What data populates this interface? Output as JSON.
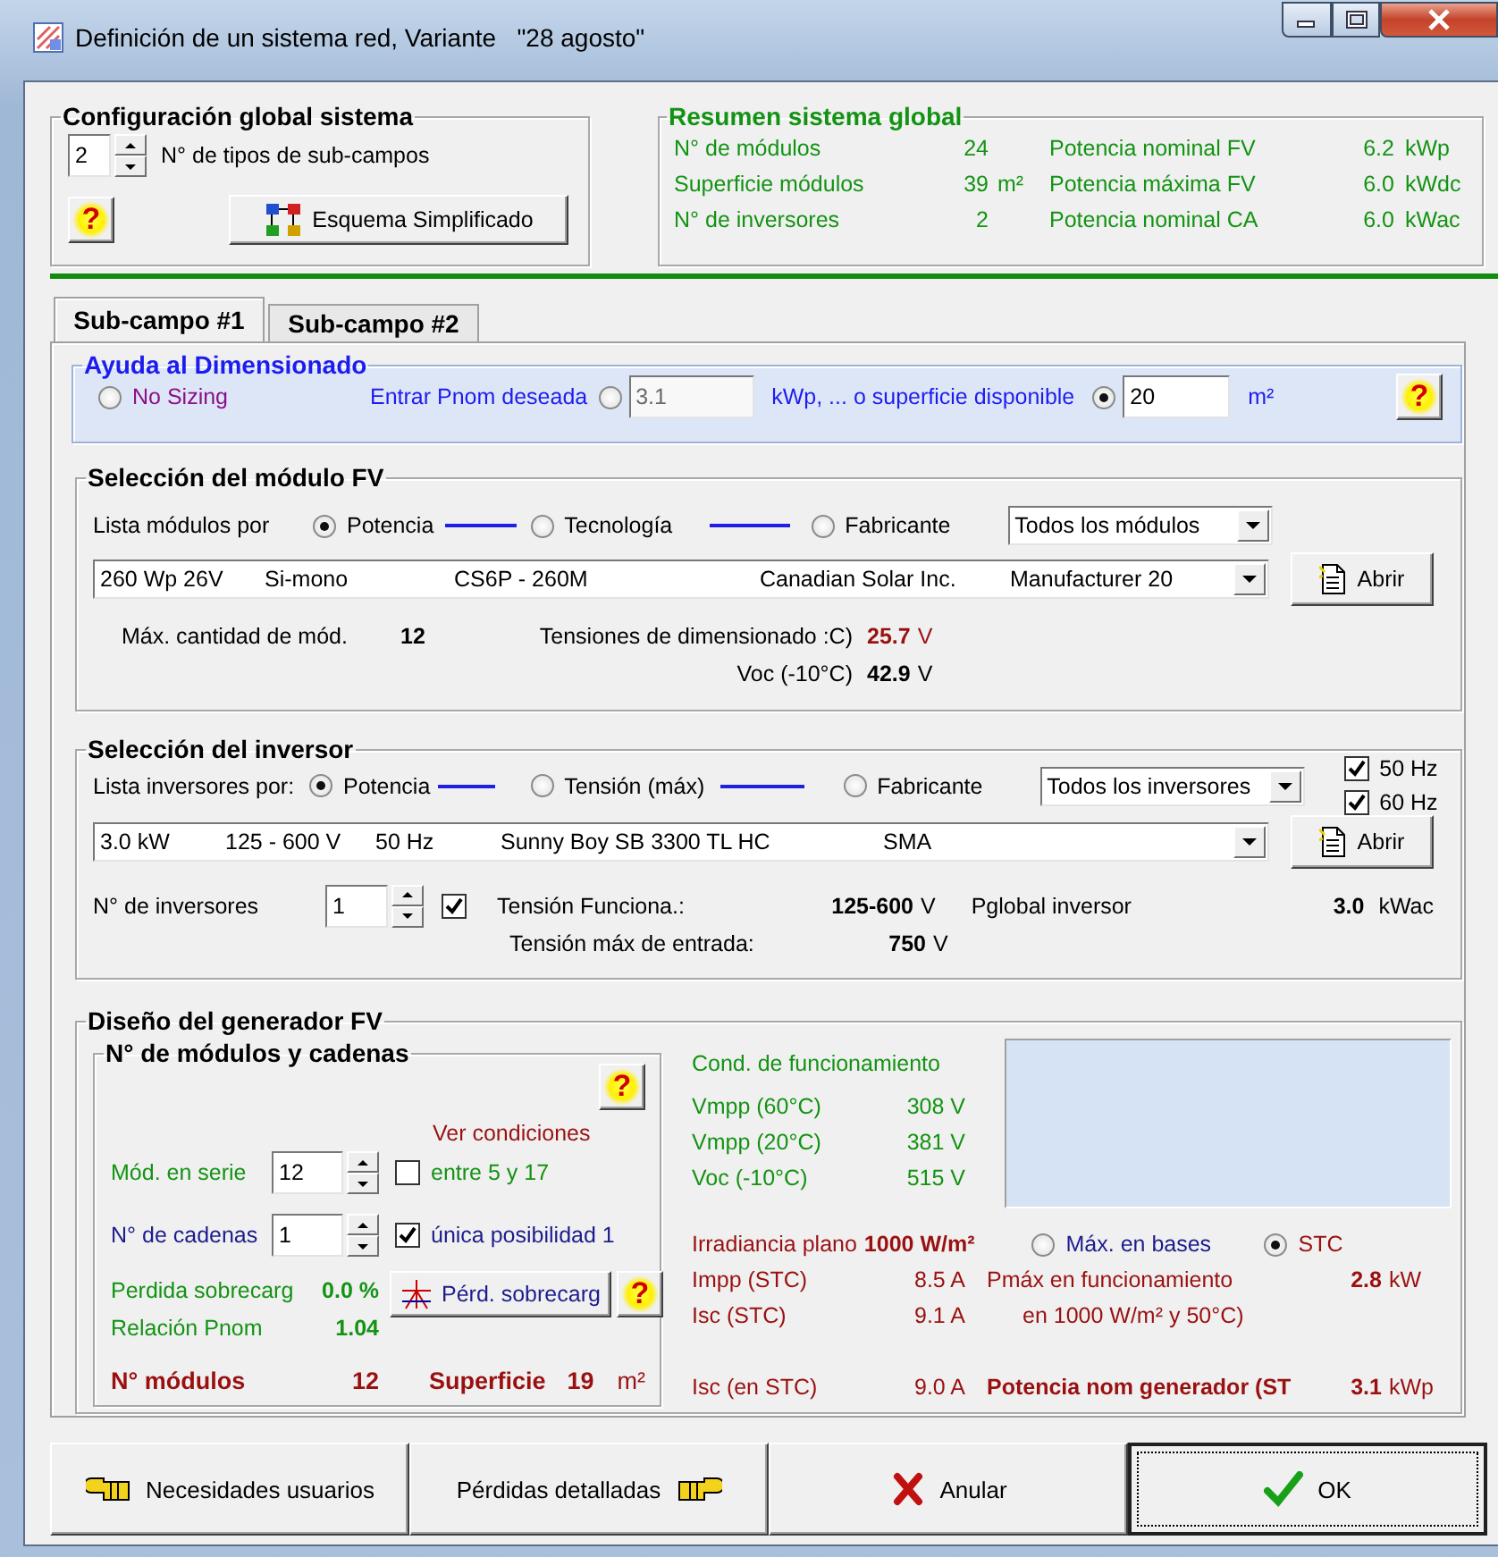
{
  "window": {
    "title": "Definición de un sistema red, Variante   \"28 agosto\""
  },
  "global_config": {
    "title": "Configuración global sistema",
    "subfield_types": "2",
    "subfield_types_label": "N° de tipos de sub-campos",
    "help": "?",
    "schema_button": "Esquema Simplificado"
  },
  "summary": {
    "title": "Resumen sistema global",
    "rows": [
      {
        "label": "N° de módulos",
        "value": "24",
        "label_2": "Potencia nominal FV",
        "value_2": "6.2",
        "unit_2": "kWp"
      },
      {
        "label": "Superficie módulos",
        "value": "39",
        "unit": "m²",
        "label_2": "Potencia máxima FV",
        "value_2": "6.0",
        "unit_2": "kWdc"
      },
      {
        "label": "N° de inversores",
        "value": "2",
        "label_2": "Potencia nominal CA",
        "value_2": "6.0",
        "unit_2": "kWac"
      }
    ]
  },
  "tabs": [
    {
      "label": "Sub-campo #1",
      "selected": true
    },
    {
      "label": "Sub-campo #2",
      "selected": false
    }
  ],
  "sizing": {
    "title": "Ayuda al Dimensionado",
    "no_sizing": {
      "label": "No Sizing",
      "selected": false
    },
    "power": {
      "label": "Entrar Pnom deseada",
      "selected": false,
      "value": "3.1",
      "unit": "kWp, ... o superficie disponible"
    },
    "area": {
      "selected": true,
      "value": "20",
      "unit": "m²"
    },
    "help": "?"
  },
  "module": {
    "title": "Selección del módulo FV",
    "sort_label": "Lista módulos por",
    "sort_by": [
      {
        "label": "Potencia",
        "selected": true
      },
      {
        "label": "Tecnología",
        "selected": false
      },
      {
        "label": "Fabricante",
        "selected": false
      }
    ],
    "filter": "Todos los módulos",
    "selection": [
      "260 Wp 26V",
      "Si-mono",
      "CS6P - 260M",
      "Canadian Solar Inc.",
      "Manufacturer 20"
    ],
    "open_button": "Abrir",
    "max_label": "Máx. cantidad de mód.",
    "max_value": "12",
    "voltages": [
      {
        "label": "Tensiones de dimensionado :C)",
        "value": "25.7",
        "unit": "V",
        "warning": true
      },
      {
        "label": "Voc (-10°C)",
        "value": "42.9",
        "unit": "V",
        "warning": false
      }
    ]
  },
  "inverter": {
    "title": "Selección del inversor",
    "sort_label": "Lista inversores por:",
    "sort_by": [
      {
        "label": "Potencia",
        "selected": true
      },
      {
        "label": "Tensión (máx)",
        "selected": false
      },
      {
        "label": "Fabricante",
        "selected": false
      }
    ],
    "filter": "Todos los inversores",
    "frequencies": [
      {
        "label": "50 Hz",
        "checked": true
      },
      {
        "label": "60 Hz",
        "checked": true
      }
    ],
    "selection": [
      "3.0 kW",
      "125 - 600 V",
      "50 Hz",
      "Sunny Boy SB 3300 TL HC",
      "SMA"
    ],
    "open_button": "Abrir",
    "count_label": "N° de inversores",
    "count": "1",
    "count_checked": true,
    "voltages": [
      {
        "label": "Tensión Funciona.:",
        "value": "125-600",
        "unit": "V"
      },
      {
        "label": "Tensión máx de entrada:",
        "value": "750",
        "unit": "V"
      }
    ],
    "global_label": "Pglobal inversor",
    "global_value": "3.0",
    "global_unit": "kWac"
  },
  "generator": {
    "title": "Diseño del generador FV",
    "strings_box": {
      "title": "N° de módulos y cadenas",
      "help": "?",
      "conditions_label": "Ver condiciones",
      "series": {
        "label": "Mód. en serie",
        "value": "12",
        "check_label": "entre 5 y 17",
        "checked": false
      },
      "strings": {
        "label": "N° de cadenas",
        "value": "1",
        "check_label": "única posibilidad 1",
        "checked": true
      },
      "loss": {
        "label": "Perdida sobrecarg",
        "value": "0.0 %"
      },
      "ratio": {
        "label": "Relación Pnom",
        "value": "1.04"
      },
      "loss_button": "Pérd. sobrecarg",
      "help_2": "?",
      "modules_label": "N° módulos",
      "modules": "12",
      "area_label": "Superficie",
      "area": "19",
      "area_unit": "m²"
    },
    "operating": {
      "title": "Cond. de funcionamiento",
      "voltages": [
        {
          "label": "Vmpp (60°C)",
          "value": "308 V"
        },
        {
          "label": "Vmpp (20°C)",
          "value": "381 V"
        },
        {
          "label": "Voc (-10°C)",
          "value": "515 V"
        }
      ],
      "irradiance_label": "Irradiancia plano",
      "irradiance": "1000 W/m²",
      "modes": [
        {
          "label": "Máx. en bases",
          "selected": false
        },
        {
          "label": "STC",
          "selected": true
        }
      ],
      "currents": [
        {
          "label": "Impp (STC)",
          "value": "8.5 A"
        },
        {
          "label": "Isc (STC)",
          "value": "9.1 A"
        }
      ],
      "pmax_label": "Pmáx en funcionamiento",
      "pmax": "2.8",
      "pmax_unit": "kW",
      "pmax_note": "en 1000 W/m² y 50°C)",
      "isc_label": "Isc (en STC)",
      "isc": "9.0 A",
      "nominal_label": "Potencia nom generador (ST",
      "nominal": "3.1",
      "nominal_unit": "kWp"
    }
  },
  "buttons": [
    {
      "label": "Necesidades usuarios",
      "kind": "back",
      "default": false
    },
    {
      "label": "Pérdidas detalladas",
      "kind": "forward",
      "default": false
    },
    {
      "label": "Anular",
      "kind": "cancel",
      "default": false
    },
    {
      "label": "OK",
      "kind": "ok",
      "default": true
    }
  ]
}
